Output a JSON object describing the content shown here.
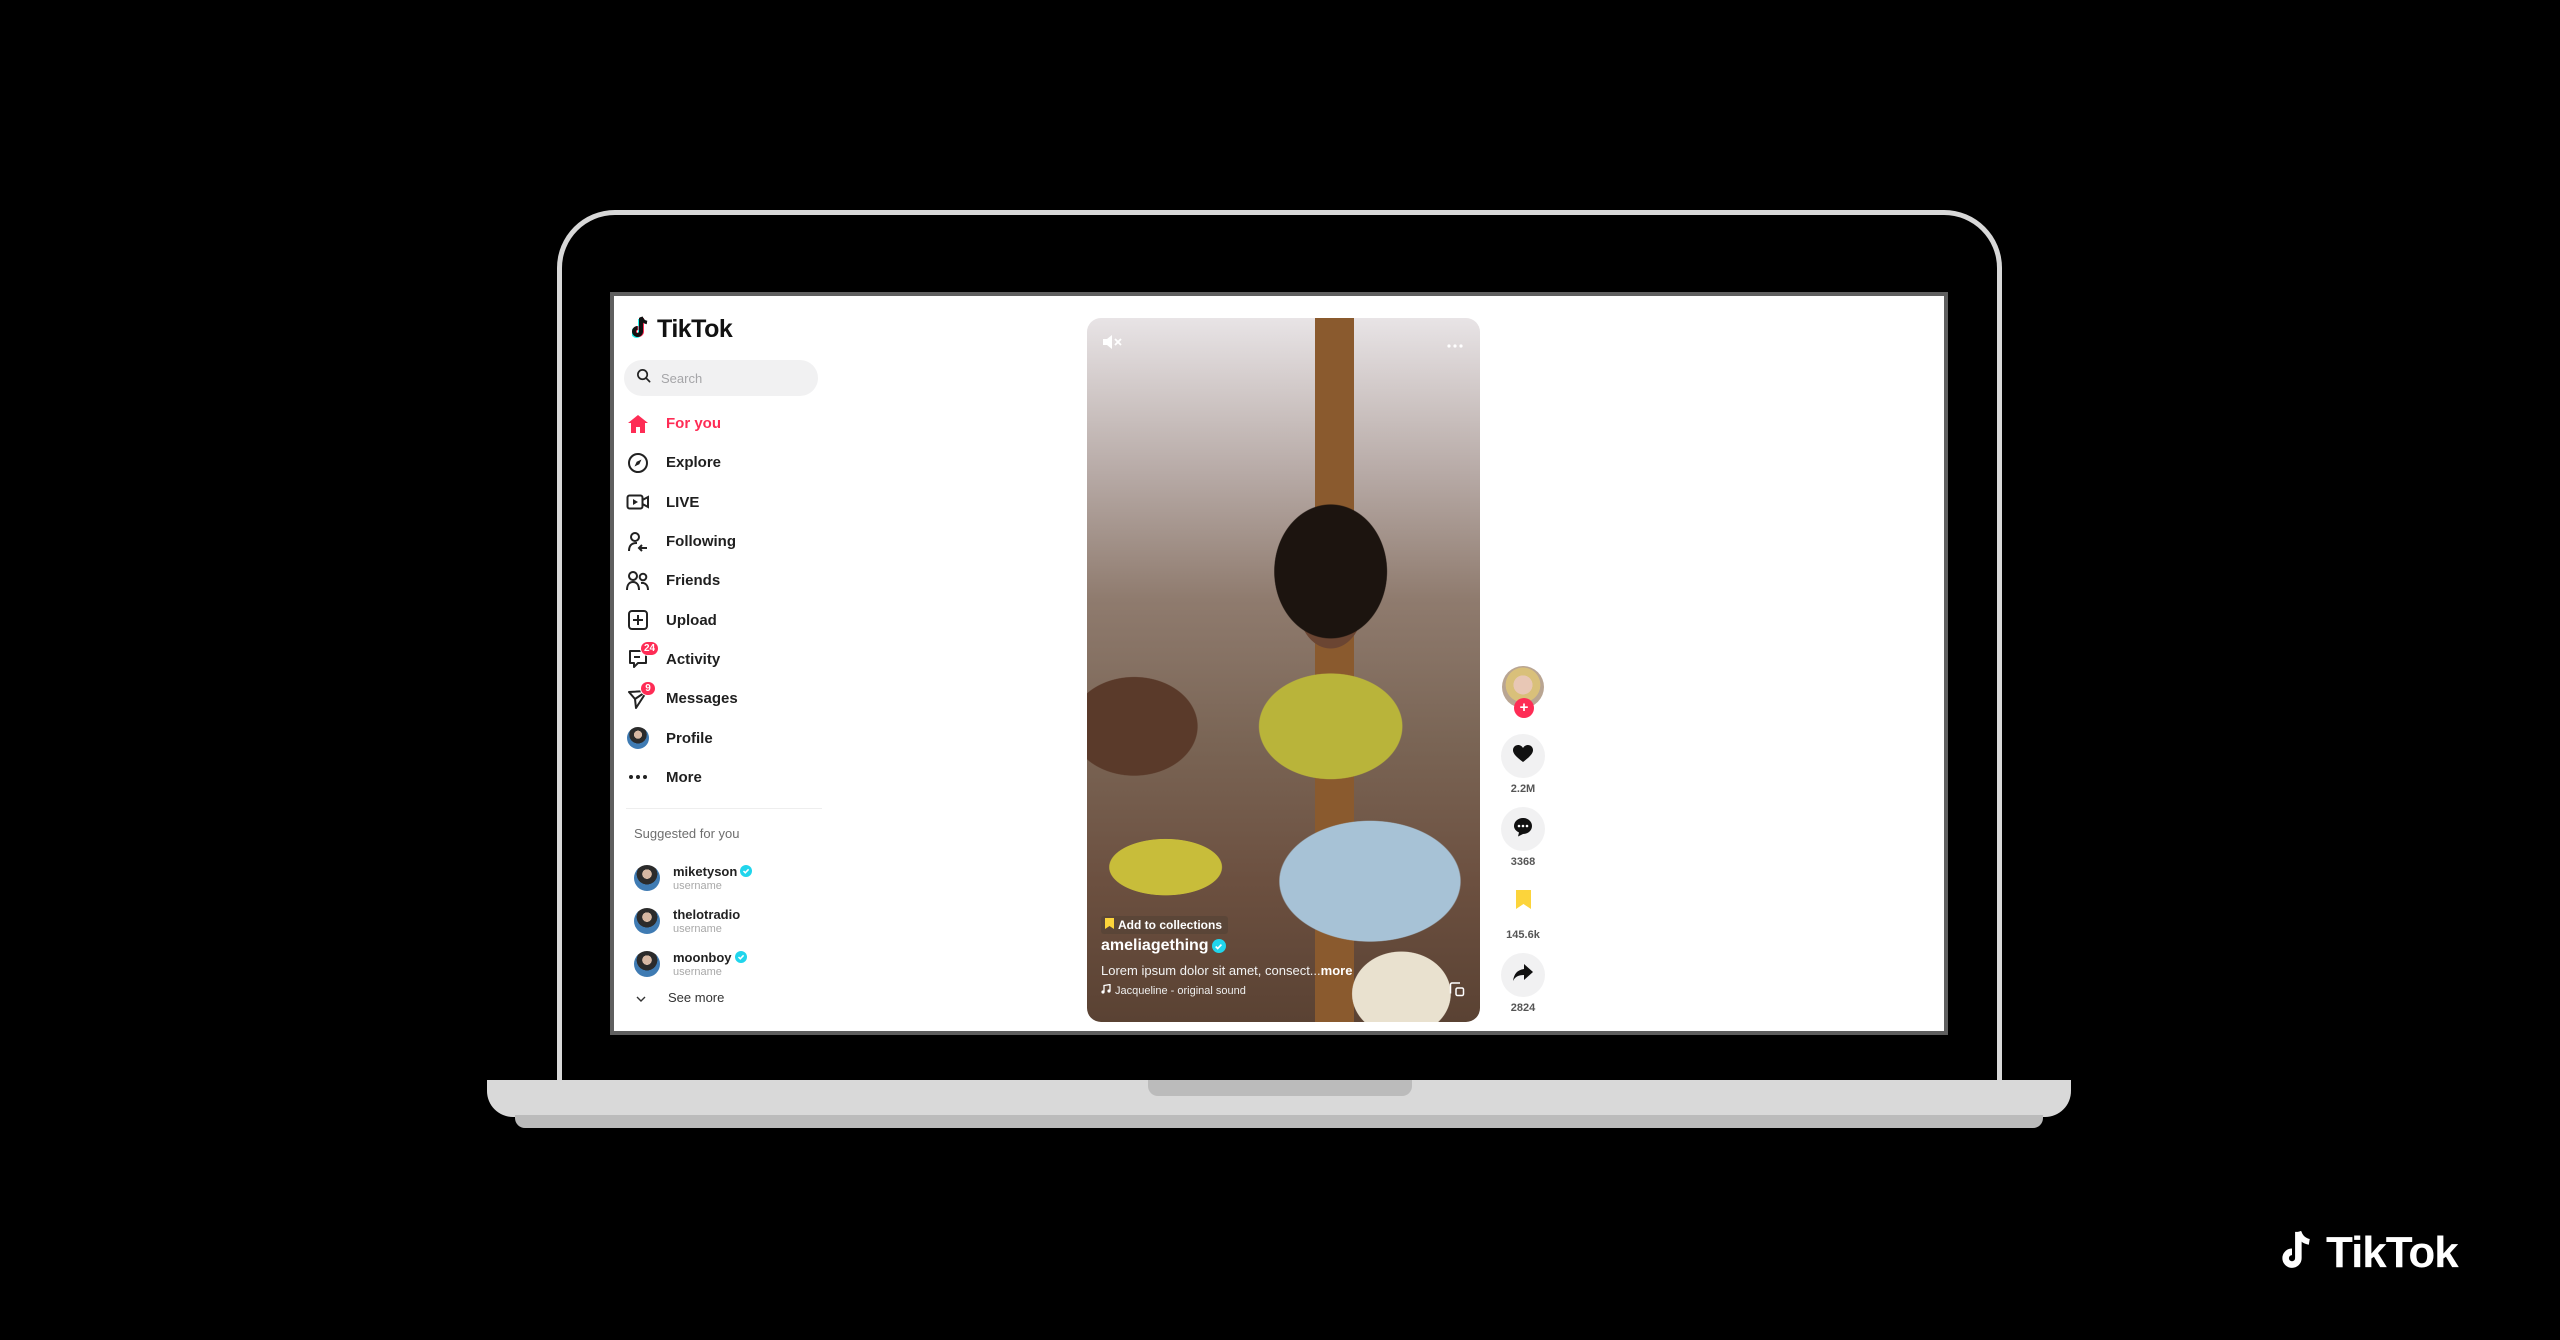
{
  "app": {
    "name": "TikTok"
  },
  "sidebar": {
    "search": {
      "placeholder": "Search",
      "value": ""
    },
    "nav": [
      {
        "label": "For you",
        "icon": "home-icon",
        "active": true
      },
      {
        "label": "Explore",
        "icon": "compass-icon"
      },
      {
        "label": "LIVE",
        "icon": "live-video-icon"
      },
      {
        "label": "Following",
        "icon": "following-icon"
      },
      {
        "label": "Friends",
        "icon": "friends-icon"
      },
      {
        "label": "Upload",
        "icon": "upload-icon"
      },
      {
        "label": "Activity",
        "icon": "activity-icon",
        "badge": "24"
      },
      {
        "label": "Messages",
        "icon": "messages-icon",
        "badge": "9"
      },
      {
        "label": "Profile",
        "icon": "profile-avatar"
      },
      {
        "label": "More",
        "icon": "more-dots-icon"
      }
    ],
    "suggested": {
      "title": "Suggested for you",
      "accounts": [
        {
          "name": "miketyson",
          "sub": "username",
          "verified": true
        },
        {
          "name": "thelotradio",
          "sub": "username",
          "verified": false
        },
        {
          "name": "moonboy",
          "sub": "username",
          "verified": true
        }
      ],
      "see_more": "See more"
    }
  },
  "video": {
    "collections_label": "Add to collections",
    "author": "ameliagething",
    "author_verified": true,
    "caption": "Lorem ipsum dolor sit amet, consect...",
    "caption_more": "more",
    "sound": "Jacqueline - original sound"
  },
  "actions": {
    "likes": "2.2M",
    "comments": "3368",
    "saves": "145.6k",
    "shares": "2824"
  },
  "colors": {
    "accent": "#fe2c55",
    "verified": "#20d5ec",
    "save": "#fcd43b"
  },
  "brand_watermark": "TikTok"
}
